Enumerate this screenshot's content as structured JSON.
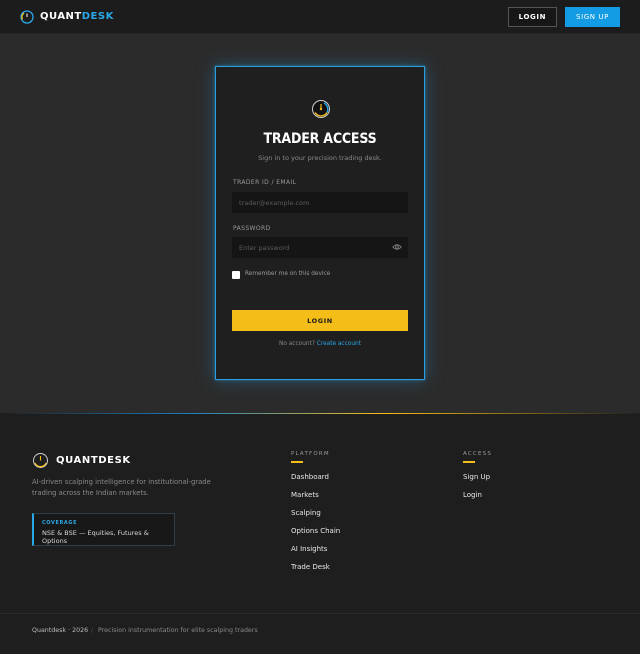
{
  "header": {
    "brand_q": "QUANT",
    "brand_d": "DESK",
    "login_label": "LOGIN",
    "signup_label": "SIGN UP"
  },
  "login_card": {
    "title": "TRADER ACCESS",
    "subtitle": "Sign in to your precision trading desk.",
    "id_label": "TRADER ID / EMAIL",
    "id_placeholder": "trader@example.com",
    "password_label": "PASSWORD",
    "password_placeholder": "Enter password",
    "remember_label": "Remember me on this device",
    "submit_label": "LOGIN",
    "no_account_text": "No account?",
    "create_account_link": "Create account"
  },
  "footer": {
    "brand": "QUANTDESK",
    "description": "AI-driven scalping intelligence for institutional-grade trading across the Indian markets.",
    "coverage_label": "COVERAGE",
    "coverage_value": "NSE & BSE — Equities, Futures & Options",
    "platform_heading": "PLATFORM",
    "platform_links": [
      "Dashboard",
      "Markets",
      "Scalping",
      "Options Chain",
      "AI Insights",
      "Trade Desk"
    ],
    "access_heading": "ACCESS",
    "access_links": [
      "Sign Up",
      "Login"
    ],
    "copyright": "Quantdesk · 2026",
    "separator": "/",
    "tagline": "Precision instrumentation for elite scalping traders"
  },
  "colors": {
    "accent_blue": "#139ce3",
    "accent_yellow": "#f5bd17",
    "background": "#2b2b2b"
  }
}
